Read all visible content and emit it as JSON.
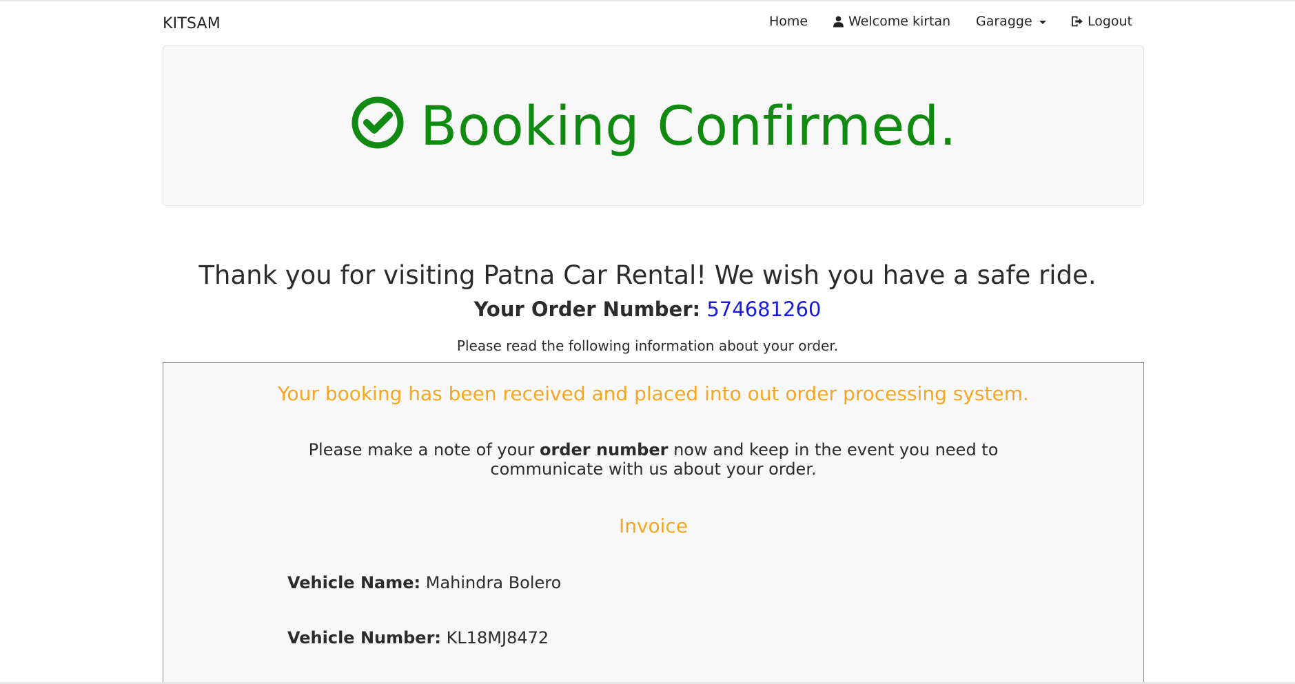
{
  "navbar": {
    "brand": "KITSAM",
    "items": [
      {
        "label": "Home",
        "icon": null
      },
      {
        "label": "Welcome kirtan",
        "icon": "user-icon"
      },
      {
        "label": "Garagge",
        "icon": "chevron-down-icon"
      },
      {
        "label": "Logout",
        "icon": "logout-icon"
      }
    ]
  },
  "jumbotron": {
    "title": "Booking Confirmed.",
    "icon": "check-circle-icon",
    "color": "#118a11"
  },
  "content": {
    "thanks": "Thank you for visiting Patna Car Rental! We wish you have a safe ride.",
    "order_label": "Your Order Number:",
    "order_number": "574681260",
    "read_info": "Please read the following information about your order."
  },
  "panel": {
    "received": "Your booking has been received and placed into out order processing system.",
    "note_before": "Please make a note of your ",
    "note_bold": "order number",
    "note_after": " now and keep in the event you need to communicate with us about your order.",
    "invoice_title": "Invoice",
    "fields": [
      {
        "label": "Vehicle Name:",
        "value": "Mahindra Bolero"
      },
      {
        "label": "Vehicle Number:",
        "value": "KL18MJ8472"
      }
    ],
    "accent_color": "#f5a623"
  }
}
